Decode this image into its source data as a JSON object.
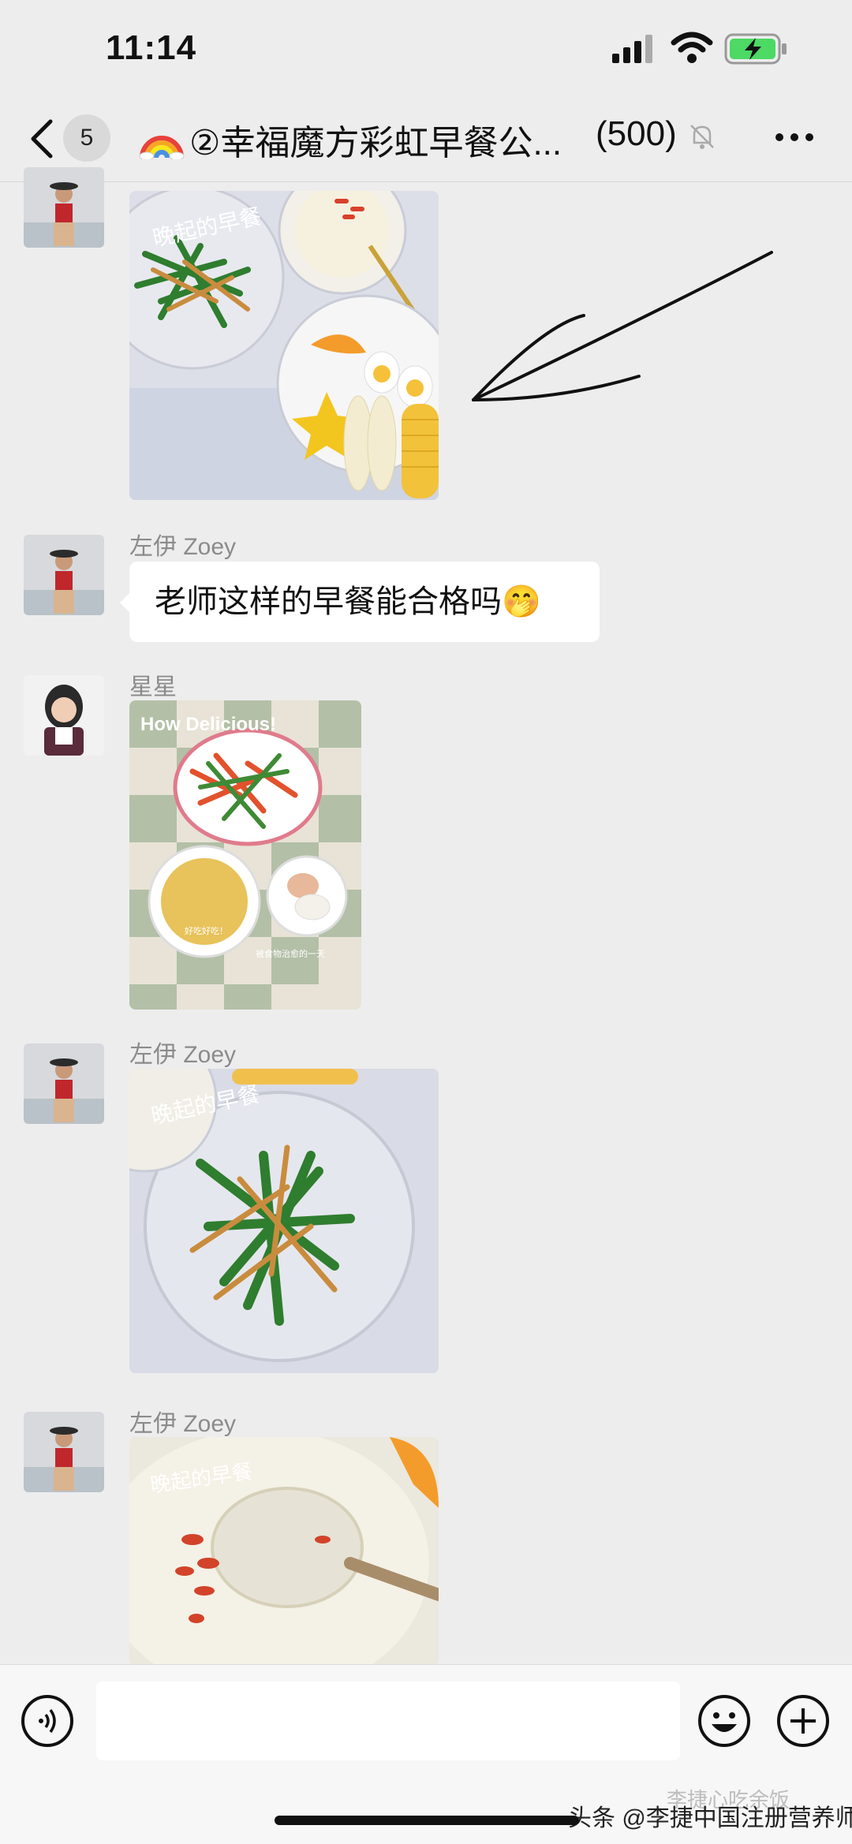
{
  "status_bar": {
    "time": "11:14"
  },
  "header": {
    "back_badge": "5",
    "title": "②幸福魔方彩虹早餐公...",
    "member_count": "(500)"
  },
  "messages": [
    {
      "sender": "",
      "type": "image"
    },
    {
      "sender": "左伊 Zoey",
      "type": "text",
      "text": "老师这样的早餐能合格吗🤭"
    },
    {
      "sender": "星星",
      "type": "image",
      "image_caption": "How Delicious!",
      "image_note1": "好吃好吃！",
      "image_note2": "被食物治愈的一天"
    },
    {
      "sender": "左伊 Zoey",
      "type": "image",
      "image_caption": "晚起的早餐"
    },
    {
      "sender": "左伊 Zoey",
      "type": "image",
      "image_caption": "晚起的早餐"
    }
  ],
  "first_image_caption": "晚起的早餐",
  "watermark": "头条 @李捷中国注册营养师",
  "watermark_faded": "李捷心吃余饭"
}
